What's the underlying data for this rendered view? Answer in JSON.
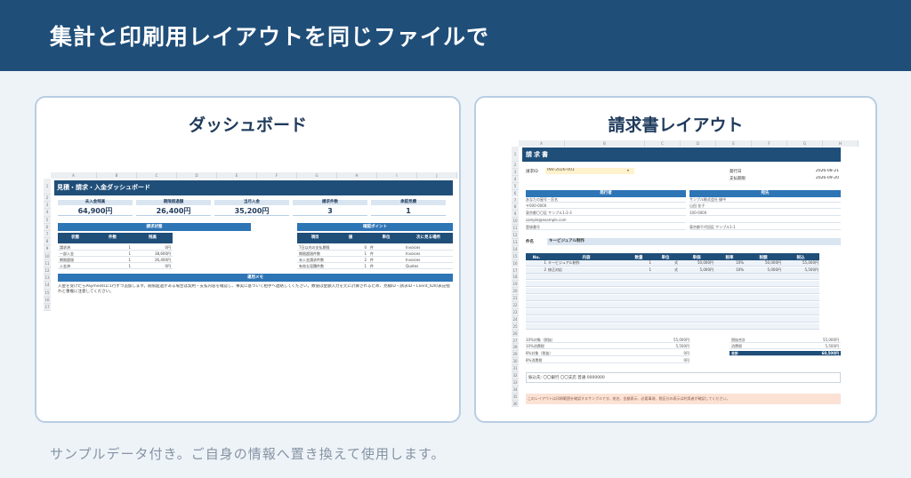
{
  "header": {
    "title": "集計と印刷用レイアウトを同じファイルで"
  },
  "footer": {
    "text": "サンプルデータ付き。ご自身の情報へ置き換えて使用します。"
  },
  "dashboard_card": {
    "title": "ダッシュボード",
    "columns": [
      "A",
      "B",
      "C",
      "D",
      "E",
      "F",
      "G",
      "H",
      "I",
      "J"
    ],
    "rows": [
      "1",
      "2",
      "3",
      "4",
      "5",
      "6",
      "7",
      "8",
      "9",
      "10",
      "11",
      "12",
      "13",
      "14",
      "15",
      "16",
      "17"
    ],
    "sheet_title": "見積・請求・入金ダッシュボード",
    "kpis": [
      {
        "label": "未入金残高",
        "value": "64,900円"
      },
      {
        "label": "期限超過額",
        "value": "26,400円"
      },
      {
        "label": "当月入金",
        "value": "35,200円"
      },
      {
        "label": "請求件数",
        "value": "3"
      },
      {
        "label": "承認見積",
        "value": "1"
      }
    ],
    "status_section": {
      "title": "請求状態",
      "headers": [
        "状態",
        "件数",
        "残高"
      ],
      "rows": [
        [
          "請求済",
          "1",
          "0円"
        ],
        [
          "一部入金",
          "1",
          "38,600円"
        ],
        [
          "期限超過",
          "1",
          "26,400円"
        ],
        [
          "入金済",
          "1",
          "0円"
        ]
      ]
    },
    "check_section": {
      "title": "確認ポイント",
      "headers": [
        "項目",
        "値",
        "単位",
        "次に見る場所"
      ],
      "rows": [
        [
          "7日以内の支払期限",
          "0",
          "件",
          "Invoices"
        ],
        [
          "期限超過件数",
          "1",
          "件",
          "Invoices"
        ],
        [
          "未入金請求件数",
          "2",
          "件",
          "Invoices"
        ],
        [
          "有効な見積件数",
          "1",
          "件",
          "Quotes"
        ]
      ]
    },
    "memo": {
      "title": "運用メモ",
      "text": "入金を受けたらPaymentsに1行ずつ追加します。期限超過がある場合は契約・支払内容を確認し、事実に基づいて相手へ連絡してください。数値は金額入力を元に計算されるため、見積ID・請求ID・Client_IDの表記揺れと重複に注意してください。"
    }
  },
  "invoice_card": {
    "title": "請求書レイアウト",
    "columns": [
      "A",
      "B",
      "C",
      "D",
      "E",
      "F",
      "G",
      "H"
    ],
    "rows": [
      "1",
      "2",
      "3",
      "4",
      "5",
      "6",
      "7",
      "8",
      "9",
      "10",
      "11",
      "12",
      "13",
      "14",
      "15",
      "16",
      "17",
      "18",
      "19",
      "20",
      "21",
      "22",
      "23",
      "24",
      "25",
      "26",
      "27",
      "28",
      "29",
      "30",
      "31",
      "32",
      "33",
      "34",
      "35",
      "36"
    ],
    "doc_title": "請求書",
    "invoice_id_label": "請求ID",
    "invoice_id_value": "INV-2026-001",
    "issue_label": "発行日",
    "issue_value": "2026-08-21",
    "due_label": "支払期限",
    "due_value": "2026-09-20",
    "issuer_header": "発行者",
    "recipient_header": "宛先",
    "issuer_lines": [
      "あなたの屋号・氏名",
      "〒000-0000",
      "東京都〇〇区 サンプル1-2-3",
      "sample@example.com",
      "登録番号"
    ],
    "recipient_lines": [
      "サンプル株式会社 御中",
      "山田 花子",
      "100-0000",
      "",
      "東京都千代田区 サンプル1-1"
    ],
    "subject_label": "件名",
    "subject_value": "キービジュアル制作",
    "item_headers": [
      "No.",
      "内容",
      "数量",
      "単位",
      "単価",
      "税率",
      "税額",
      "税込"
    ],
    "items": [
      [
        "1",
        "キービジュアル制作",
        "1",
        "式",
        "50,000円",
        "10%",
        "50,000円",
        "55,000円"
      ],
      [
        "2",
        "修正対応",
        "1",
        "式",
        "5,000円",
        "10%",
        "5,000円",
        "5,500円"
      ]
    ],
    "tax_rows": [
      [
        "10%対象（税抜）",
        "55,000円"
      ],
      [
        "10%消費税",
        "5,500円"
      ],
      [
        "8%対象（税抜）",
        "0円"
      ],
      [
        "8%消費税",
        "0円"
      ]
    ],
    "total_rows": [
      [
        "税抜合計",
        "55,000円"
      ],
      [
        "消費税",
        "5,500円"
      ],
      [
        "合計",
        "60,500円"
      ]
    ],
    "bank_text": "振込先: 〇〇銀行 〇〇支店 普通 0000000",
    "note_text": "このレイアウトは印刷範囲を確認するサンプルです。宛名、金額表示、必要事項、税区分の表示は利用者が確認してください。"
  }
}
